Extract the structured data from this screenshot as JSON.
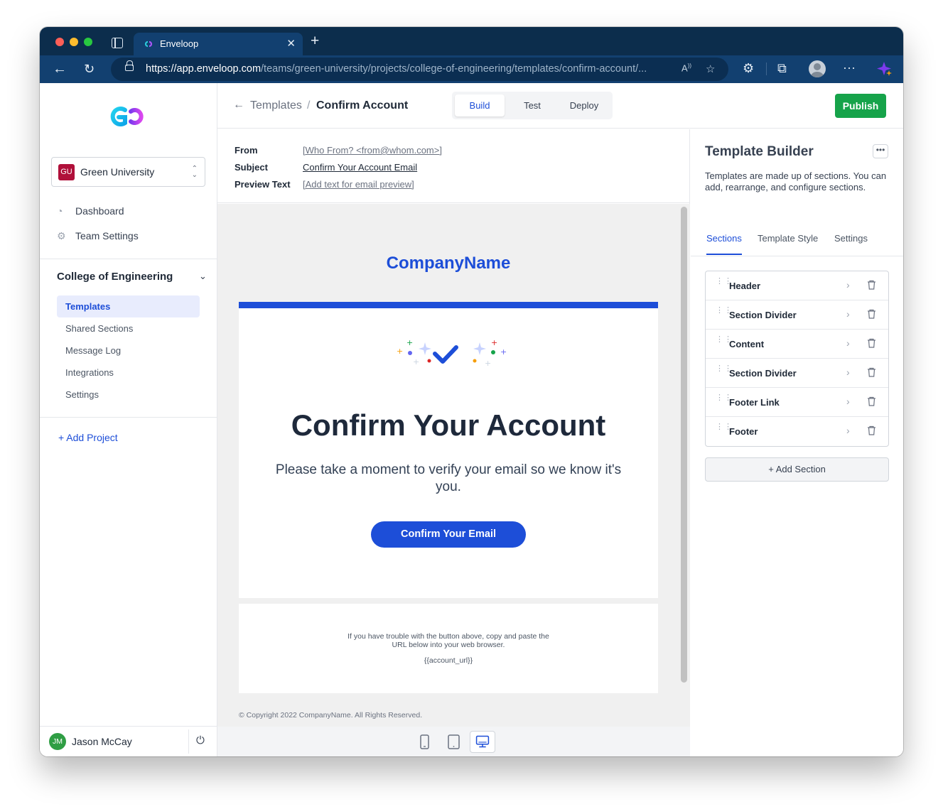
{
  "browser": {
    "tab_title": "Enveloop",
    "url_host": "https://app.enveloop.com",
    "url_path": "/teams/green-university/projects/college-of-engineering/templates/confirm-account/...",
    "colors": {
      "frame": "#0c2d4c",
      "toolbar": "#124070"
    }
  },
  "sidebar": {
    "org": {
      "badge": "GU",
      "name": "Green University"
    },
    "nav": [
      {
        "label": "Dashboard",
        "icon": "dashboard-icon"
      },
      {
        "label": "Team Settings",
        "icon": "gear-icon"
      }
    ],
    "project": {
      "title": "College of Engineering",
      "items": [
        {
          "label": "Templates",
          "active": true
        },
        {
          "label": "Shared Sections"
        },
        {
          "label": "Message Log"
        },
        {
          "label": "Integrations"
        },
        {
          "label": "Settings"
        }
      ]
    },
    "add_project": "+ Add Project",
    "user": {
      "initials": "JM",
      "name": "Jason McCay"
    }
  },
  "topbar": {
    "breadcrumb_link": "Templates",
    "breadcrumb_sep": "/",
    "breadcrumb_current": "Confirm Account",
    "modes": [
      "Build",
      "Test",
      "Deploy"
    ],
    "active_mode": "Build",
    "publish": "Publish"
  },
  "meta": {
    "from_label": "From",
    "from_value": "[Who From? <from@whom.com>]",
    "subject_label": "Subject",
    "subject_value": "Confirm Your Account Email",
    "preview_label": "Preview Text",
    "preview_value": "[Add text for email preview]"
  },
  "email": {
    "company": "CompanyName",
    "title": "Confirm Your Account",
    "body": "Please take a moment to verify your email so we know it's you.",
    "cta": "Confirm Your Email",
    "link_help": "If you have trouble with the button above, copy and paste the URL below into your web browser.",
    "link_var": "{{account_url}}",
    "copyright": "© Copyright 2022 CompanyName. All Rights Reserved.",
    "colors": {
      "brand": "#1d4ed8",
      "heading": "#1e293b"
    }
  },
  "devices": [
    "phone",
    "tablet",
    "desktop"
  ],
  "active_device": "desktop",
  "panel": {
    "title": "Template Builder",
    "description": "Templates are made up of sections. You can add, rearrange, and configure sections.",
    "tabs": [
      "Sections",
      "Template Style",
      "Settings"
    ],
    "active_tab": "Sections",
    "sections": [
      "Header",
      "Section Divider",
      "Content",
      "Section Divider",
      "Footer Link",
      "Footer"
    ],
    "add_section": "+ Add Section"
  }
}
